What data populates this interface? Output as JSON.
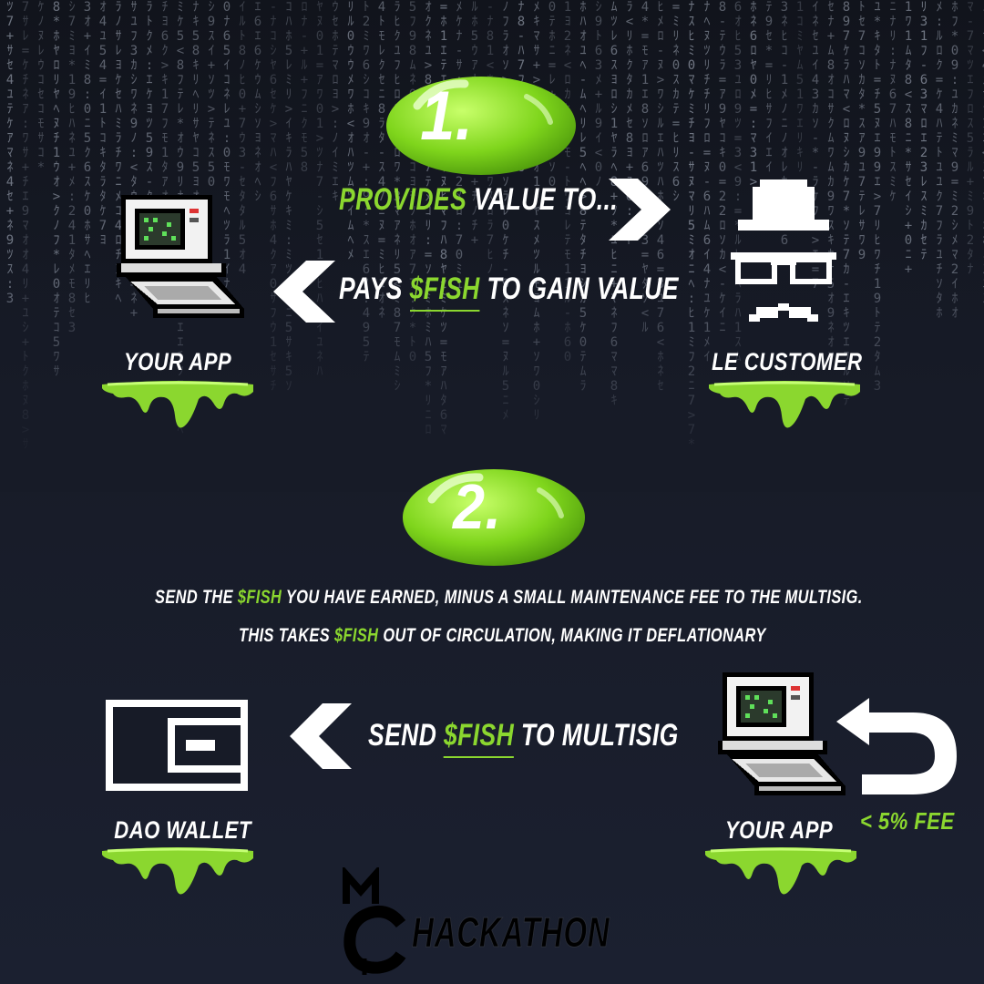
{
  "step1": {
    "number": "1.",
    "provides": {
      "highlight": "Provides",
      "rest": " value to..."
    },
    "pays": {
      "prefix": "Pays ",
      "highlight": "$FISH",
      "rest": " to gain value"
    },
    "left_label": "Your App",
    "right_label": "Le Customer"
  },
  "step2": {
    "number": "2.",
    "line1": {
      "prefix": "Send the ",
      "highlight": "$FISH",
      "rest": " you have earned, minus a small maintenance fee to the multisig."
    },
    "line2": {
      "prefix": "This takes ",
      "highlight": "$FISH",
      "rest": " out of circulation, making it deflationary"
    },
    "send": {
      "prefix": "Send ",
      "highlight": "$FISH",
      "rest": " to multisig"
    },
    "left_label": "DAO Wallet",
    "right_label": "Your App",
    "fee": "< 5% fee"
  },
  "logo": {
    "text": "HACKATHON"
  },
  "colors": {
    "accent": "#8bd72f",
    "background": "#171b27"
  }
}
